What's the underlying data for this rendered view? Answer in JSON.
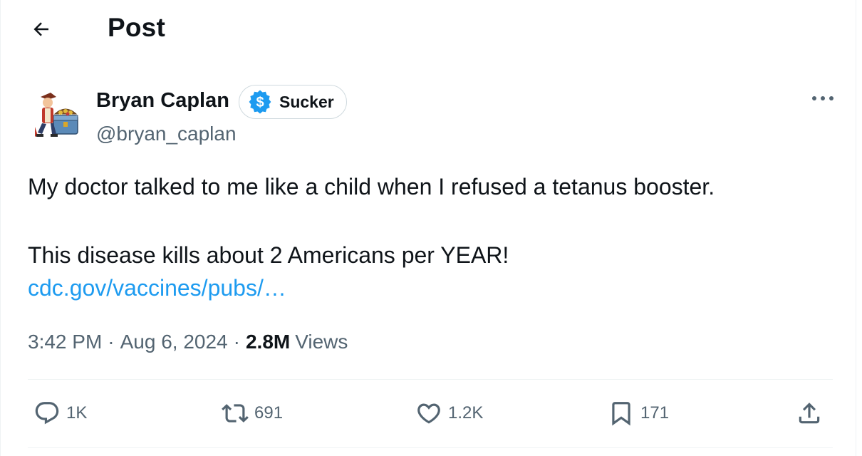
{
  "header": {
    "title": "Post",
    "back_icon": "arrow-left-icon"
  },
  "author": {
    "name": "Bryan Caplan",
    "handle": "@bryan_caplan",
    "badge_label": "Sucker",
    "badge_icon": "dollar-badge-icon",
    "badge_color": "#1d9bf0"
  },
  "post": {
    "text_line1": "My doctor talked to me like a child when I refused a tetanus booster.",
    "text_line2": "This disease kills about 2 Americans per YEAR!",
    "link": "cdc.gov/vaccines/pubs/…",
    "time": "3:42 PM",
    "date": "Aug 6, 2024",
    "separator": "·",
    "views_count": "2.8M",
    "views_label": "Views"
  },
  "actions": {
    "replies": "1K",
    "reposts": "691",
    "likes": "1.2K",
    "bookmarks": "171"
  },
  "colors": {
    "link": "#1d9bf0",
    "secondary_text": "#536471",
    "primary_text": "#0f1419"
  }
}
